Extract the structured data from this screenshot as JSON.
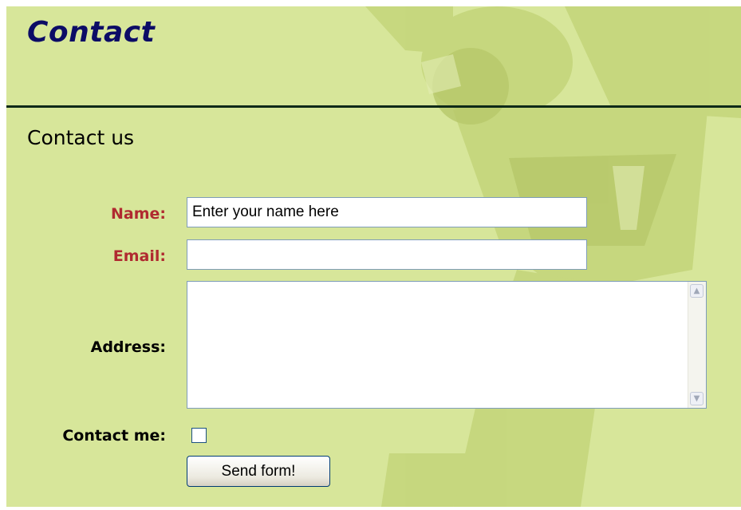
{
  "page": {
    "title": "Contact",
    "subtitle": "Contact us"
  },
  "form": {
    "name": {
      "label": "Name:",
      "value": "Enter your name here",
      "required": true
    },
    "email": {
      "label": "Email:",
      "value": "",
      "required": true
    },
    "address": {
      "label": "Address:",
      "value": ""
    },
    "contact_me": {
      "label": "Contact me:",
      "checked": false
    },
    "submit_label": "Send form!"
  },
  "colors": {
    "background": "#d7e69a",
    "title": "#0c0c66",
    "required_label": "#b02a30",
    "rule": "#0e2a18"
  },
  "icons": [
    "soccer-player-watermark",
    "scroll-up-icon",
    "scroll-down-icon"
  ]
}
